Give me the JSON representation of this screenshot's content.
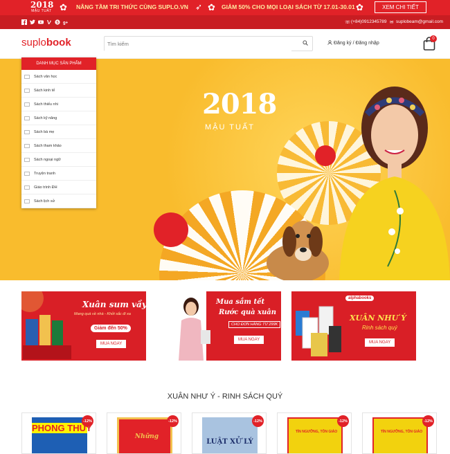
{
  "promo": {
    "logo_year": "2018",
    "logo_sub": "MẬU TUẤT",
    "message1": "NÂNG TẦM TRI THỨC CÙNG SUPLO.VN",
    "message2": "GIẢM 50% CHO MỌI LOẠI SÁCH TỪ 17.01-30.01",
    "cta": "XEM CHI TIẾT"
  },
  "topbar": {
    "social_icons": [
      "facebook-icon",
      "twitter-icon",
      "youtube-icon",
      "vine-icon",
      "skype-icon",
      "google-plus-icon"
    ],
    "phone": "(+84)0912345789",
    "email": "suplobeam@gmail.com"
  },
  "header": {
    "brand_part1": "suplo",
    "brand_part2": "book",
    "search_placeholder": "Tìm kiếm",
    "auth": "Đăng ký / Đăng nhập",
    "cart_count": "0"
  },
  "sidebar": {
    "title": "DANH MỤC SẢN PHẨM",
    "items": [
      "Sách văn học",
      "Sách kinh tế",
      "Sách thiếu nhi",
      "Sách kỹ năng",
      "Sách bà mẹ",
      "Sách tham khảo",
      "Sách ngoại ngữ",
      "Truyện tranh",
      "Giáo trình ĐH",
      "Sách lịch sử"
    ]
  },
  "hero": {
    "year": "2018",
    "subtitle": "MẬU TUẤT"
  },
  "banners": [
    {
      "title": "Xuân sum vầy",
      "subtitle": "Mang quà về nhà - Khởi sắc đi xa",
      "highlight": "Giảm đến 50%",
      "button": "MUA NGAY"
    },
    {
      "title": "Mua sắm tết",
      "title2": "Rước quà xuân",
      "subtitle": "CHO ĐƠN HÀNG TỪ 299K",
      "button": "MUA NGAY"
    },
    {
      "brand": "alphabooks",
      "title": "XUÂN NHƯ Ý",
      "subtitle": "Rinh sách quý",
      "button": "MUA NGAY"
    }
  ],
  "section": {
    "title": "XUÂN NHƯ Ý - RINH SÁCH QUÝ"
  },
  "books": [
    {
      "discount": "-12%",
      "cover_title": "PHONG THỦY"
    },
    {
      "discount": "-12%",
      "cover_title": "Những"
    },
    {
      "discount": "-12%",
      "cover_title": "LUẬT XỬ LÝ"
    },
    {
      "discount": "-12%",
      "cover_title": "TÍN NGƯỠNG, TÔN GIÁO"
    },
    {
      "discount": "-12%",
      "cover_title": "TÍN NGƯỠNG, TÔN GIÁO"
    }
  ],
  "colors": {
    "brand_red": "#e12228",
    "dark_red": "#c81d22",
    "hero_yellow": "#f9bc2d"
  }
}
